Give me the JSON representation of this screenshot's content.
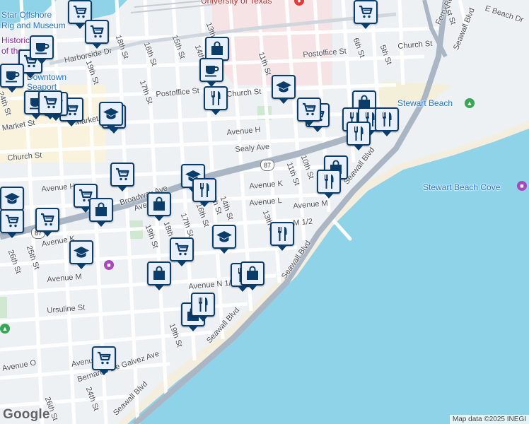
{
  "map": {
    "attribution": "Map data ©2025 INEGI",
    "logo": "Google",
    "route_shield": "87",
    "places": [
      {
        "text": "University of Texas",
        "kind": "red"
      },
      {
        "text": "Star Offshore",
        "kind": "poi"
      },
      {
        "text": "Rig and Museum",
        "kind": "poi"
      },
      {
        "text": "Historic",
        "kind": "purple"
      },
      {
        "text": "of the",
        "kind": "purple"
      },
      {
        "text": "Downtown",
        "kind": "poi"
      },
      {
        "text": "Seaport",
        "kind": "poi"
      },
      {
        "text": "Stewart Beach",
        "kind": "poi"
      },
      {
        "text": "Stewart Beach Cove",
        "kind": "poi"
      }
    ],
    "streets": [
      "Harborside Dr",
      "19th St",
      "18th St",
      "16th St",
      "15th St",
      "14th St",
      "13th St",
      "11th St",
      "Postoffice St",
      "Church St",
      "6th St",
      "5th St",
      "Ferry Rd",
      "1st St",
      "Seawall Blvd",
      "E Beach Dr",
      "24th St",
      "Postoffice St",
      "Church St",
      "17th St",
      "Market St",
      "Avenue H",
      "Sealy Ave",
      "Church St",
      "Broadway Ave",
      "10th St",
      "11th St",
      "Avenue K",
      "Avenue L",
      "Avenue M",
      "Seawall Blvd",
      "Avenue H",
      "Avenue K",
      "19th St",
      "18th St",
      "17th St",
      "16th St",
      "15th St",
      "14th St",
      "13th St",
      "M 1/2",
      "26th St",
      "25th St",
      "Avenue K",
      "Avenue M",
      "Seawall Blvd",
      "Avenue N 1/2",
      "Ursuline St",
      "19th St",
      "Avenue O",
      "Bernardo De Galvez Ave",
      "Seawall Blvd",
      "26th St",
      "24th St",
      "Avenue N",
      "Seawall Blvd",
      "Market St"
    ],
    "markers": [
      "shopping-cart",
      "shopping-cart",
      "shopping-cart",
      "shopping-cart",
      "shopping-bag",
      "coffee",
      "coffee",
      "coffee",
      "coffee",
      "shopping-cart",
      "shopping-cart",
      "school",
      "restaurant",
      "school",
      "shopping-cart",
      "shopping-bag",
      "restaurant",
      "restaurant",
      "restaurant",
      "restaurant",
      "shopping-bag",
      "restaurant",
      "shopping-cart",
      "school",
      "restaurant",
      "shopping-bag",
      "school",
      "shopping-cart",
      "shopping-cart",
      "shopping-bag",
      "shopping-cart",
      "school",
      "shopping-cart",
      "shopping-bag",
      "school",
      "restaurant",
      "restaurant",
      "shopping-bag",
      "shopping-bag",
      "restaurant",
      "shopping-cart",
      "shopping-cart",
      "school",
      "shopping-cart"
    ]
  }
}
